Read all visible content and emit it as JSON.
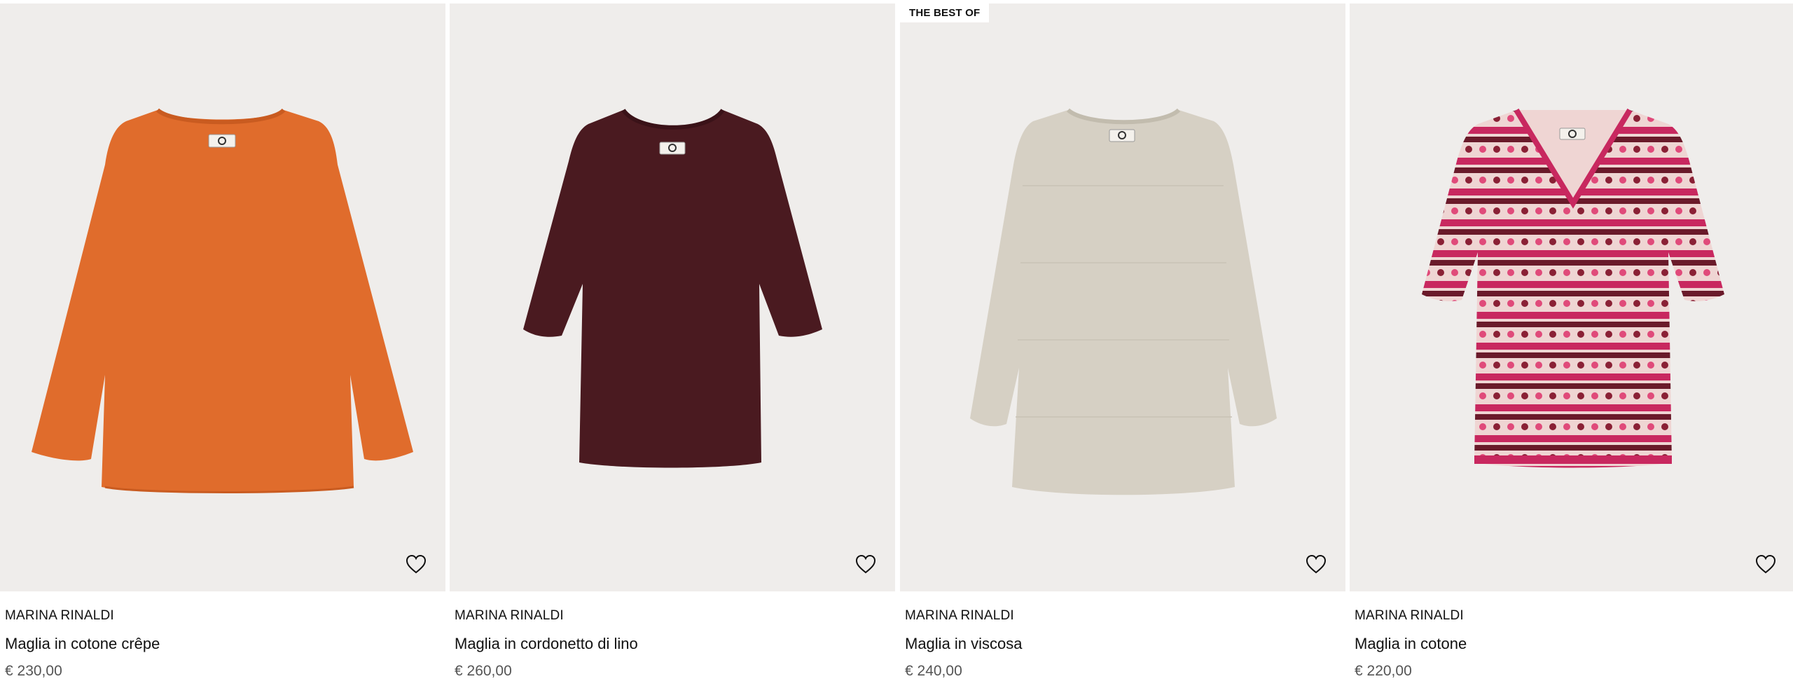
{
  "products": [
    {
      "brand": "MARINA RINALDI",
      "name": "Maglia in cotone crêpe",
      "price": "€ 230,00",
      "badge": "",
      "color": "#e06c2c",
      "wishlist_icon": "heart-outline-icon"
    },
    {
      "brand": "MARINA RINALDI",
      "name": "Maglia in cordonetto di lino",
      "price": "€ 260,00",
      "badge": "",
      "color": "#4a1a20",
      "wishlist_icon": "heart-outline-icon"
    },
    {
      "brand": "MARINA RINALDI",
      "name": "Maglia in viscosa",
      "price": "€ 240,00",
      "badge": "THE BEST OF",
      "color": "#d6d0c4",
      "wishlist_icon": "heart-outline-icon"
    },
    {
      "brand": "MARINA RINALDI",
      "name": "Maglia in cotone",
      "price": "€ 220,00",
      "badge": "",
      "color": "#c8285f",
      "wishlist_icon": "heart-outline-icon"
    }
  ]
}
